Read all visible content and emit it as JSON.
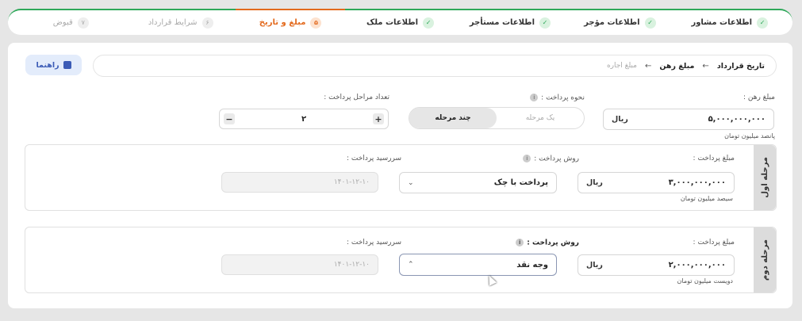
{
  "stepper": {
    "steps": [
      {
        "num": "✓",
        "label": "اطلاعات مشاور",
        "state": "done"
      },
      {
        "num": "✓",
        "label": "اطلاعات مؤجر",
        "state": "done"
      },
      {
        "num": "✓",
        "label": "اطلاعات مستأجر",
        "state": "done"
      },
      {
        "num": "✓",
        "label": "اطلاعات ملک",
        "state": "done"
      },
      {
        "num": "۵",
        "label": "مبلغ و تاریخ",
        "state": "active"
      },
      {
        "num": "۶",
        "label": "شرایط قرارداد",
        "state": "todo"
      },
      {
        "num": "۷",
        "label": "قبوض",
        "state": "todo"
      }
    ]
  },
  "breadcrumb": {
    "item1": "تاریخ قرارداد",
    "item2": "مبلغ رهن",
    "item3": "مبلغ اجاره",
    "arrow": "←"
  },
  "help_button": {
    "label": "راهنما"
  },
  "deposit": {
    "label": "مبلغ رهن :",
    "value": "۵,۰۰۰,۰۰۰,۰۰۰",
    "unit": "ریال",
    "hint": "پانصد میلیون تومان"
  },
  "payment_method": {
    "label": "نحوه پرداخت :",
    "options": [
      "یک مرحله",
      "چند مرحله"
    ],
    "selected": "چند مرحله"
  },
  "stages_count": {
    "label": "تعداد مراحل پرداخت :",
    "value": "۲",
    "minus": "−",
    "plus": "+"
  },
  "stage1": {
    "title": "مرحله اول",
    "amount_label": "مبلغ پرداخت :",
    "amount": "۳,۰۰۰,۰۰۰,۰۰۰",
    "unit": "ریال",
    "hint": "سیصد میلیون تومان",
    "method_label": "روش پرداخت :",
    "method": "پرداخت با چک",
    "due_label": "سررسید پرداخت :",
    "due": "۱۴۰۱-۱۲-۱۰"
  },
  "stage2": {
    "title": "مرحله دوم",
    "amount_label": "مبلغ پرداخت :",
    "amount": "۲,۰۰۰,۰۰۰,۰۰۰",
    "unit": "ریال",
    "hint": "دویست میلیون تومان",
    "method_label": "روش پرداخت :",
    "method": "وجه نقد",
    "due_label": "سررسید پرداخت :",
    "due": "۱۴۰۱-۱۲-۱۰"
  },
  "icons": {
    "info": "i",
    "chevron_down": "⌄",
    "chevron_up": "⌃"
  },
  "colors": {
    "done": "#2fa85a",
    "active": "#e36a1e",
    "accent": "#3b5bb6"
  }
}
